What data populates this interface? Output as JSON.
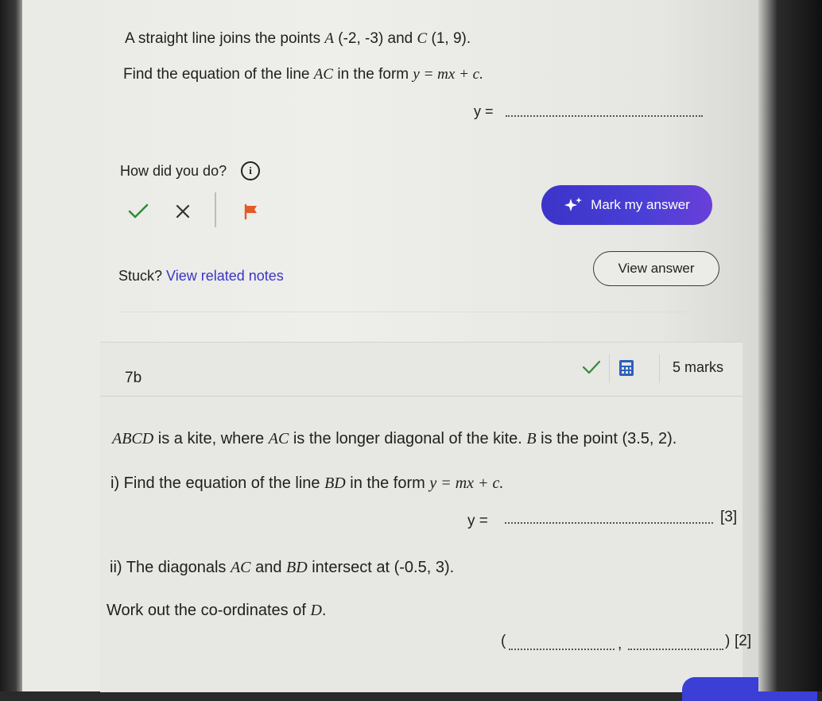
{
  "q7a": {
    "intro_prefix": "A straight line joins the points ",
    "point_a": "A",
    "point_a_coords": "(-2, -3)",
    "and_word": "and",
    "point_c": "C",
    "point_c_coords": "(1, 9).",
    "find_prefix": "Find the equation of the line ",
    "line_name": "AC",
    "find_suffix": " in the form ",
    "form": "y = mx + c.",
    "answer_label": "y ="
  },
  "feedback": {
    "how_did_you_do": "How did you do?",
    "mark_answer_label": "Mark my answer",
    "stuck_label": "Stuck?",
    "related_notes_link": "View related notes",
    "view_answer_label": "View answer"
  },
  "q7b": {
    "number": "7b",
    "marks": "5 marks",
    "statement_subject": "ABCD",
    "statement_mid": " is a kite, where ",
    "diag": "AC",
    "statement_rest": " is the longer diagonal of the kite. ",
    "point_b": "B",
    "statement_end": " is the point (3.5, 2).",
    "part_i_prefix": "i) Find the equation of the line ",
    "line_bd": "BD",
    "part_i_suffix": " in the form ",
    "form": "y = mx + c.",
    "answer_label_i": "y =",
    "marks_i": "[3]",
    "part_ii_prefix": "ii) The diagonals ",
    "part_ii_ac": "AC",
    "part_ii_and": " and ",
    "part_ii_bd": "BD",
    "part_ii_suffix": " intersect at (-0.5, 3).",
    "work_out": "Work out the co-ordinates of ",
    "point_d": "D",
    "work_out_end": ".",
    "coord_open": "(",
    "coord_comma": ",",
    "coord_close": ")",
    "marks_ii": "[2]"
  },
  "colors": {
    "accent_gradient_start": "#3b34c9",
    "accent_gradient_end": "#6a3fd8",
    "tick_green": "#2e8b3a",
    "flag_orange": "#e2592a",
    "calc_blue": "#2f5fbf",
    "link_blue": "#3a35c7"
  },
  "icons": [
    "check-icon",
    "cross-icon",
    "flag-icon",
    "info-icon",
    "sparkle-icon",
    "calculator-icon"
  ]
}
